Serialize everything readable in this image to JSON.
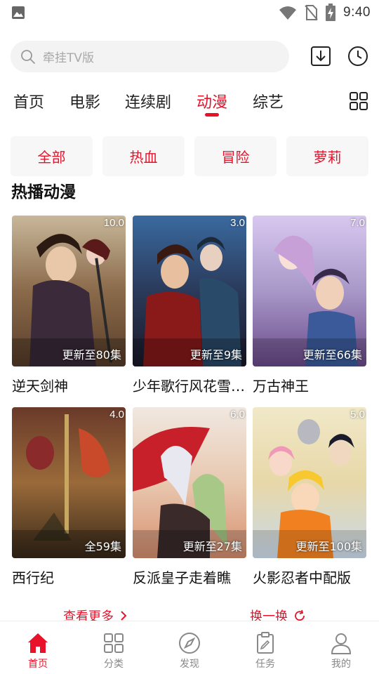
{
  "status_bar": {
    "time": "9:40"
  },
  "search": {
    "placeholder": "牵挂TV版"
  },
  "tabs": [
    {
      "label": "首页"
    },
    {
      "label": "电影"
    },
    {
      "label": "连续剧"
    },
    {
      "label": "动漫",
      "active": true
    },
    {
      "label": "综艺"
    }
  ],
  "filters": [
    {
      "label": "全部"
    },
    {
      "label": "热血"
    },
    {
      "label": "冒险"
    },
    {
      "label": "萝莉"
    }
  ],
  "section": {
    "title": "热播动漫"
  },
  "cards": [
    {
      "title": "逆天剑神",
      "score": "10.0",
      "episodes": "更新至80集"
    },
    {
      "title": "少年歌行风花雪月篇",
      "score": "3.0",
      "episodes": "更新至9集"
    },
    {
      "title": "万古神王",
      "score": "7.0",
      "episodes": "更新至66集"
    },
    {
      "title": "西行纪",
      "score": "4.0",
      "episodes": "全59集"
    },
    {
      "title": "反派皇子走着瞧",
      "score": "6.0",
      "episodes": "更新至27集"
    },
    {
      "title": "火影忍者中配版",
      "score": "5.0",
      "episodes": "更新至100集"
    }
  ],
  "actions": {
    "more": "查看更多",
    "refresh": "换一换"
  },
  "bottom_nav": [
    {
      "label": "首页",
      "icon": "home-icon",
      "active": true
    },
    {
      "label": "分类",
      "icon": "category-icon"
    },
    {
      "label": "发现",
      "icon": "compass-icon"
    },
    {
      "label": "任务",
      "icon": "task-icon"
    },
    {
      "label": "我的",
      "icon": "profile-icon"
    }
  ],
  "colors": {
    "accent": "#e8132b",
    "chip_bg": "#f7f7f7",
    "search_bg": "#f3f3f3"
  }
}
